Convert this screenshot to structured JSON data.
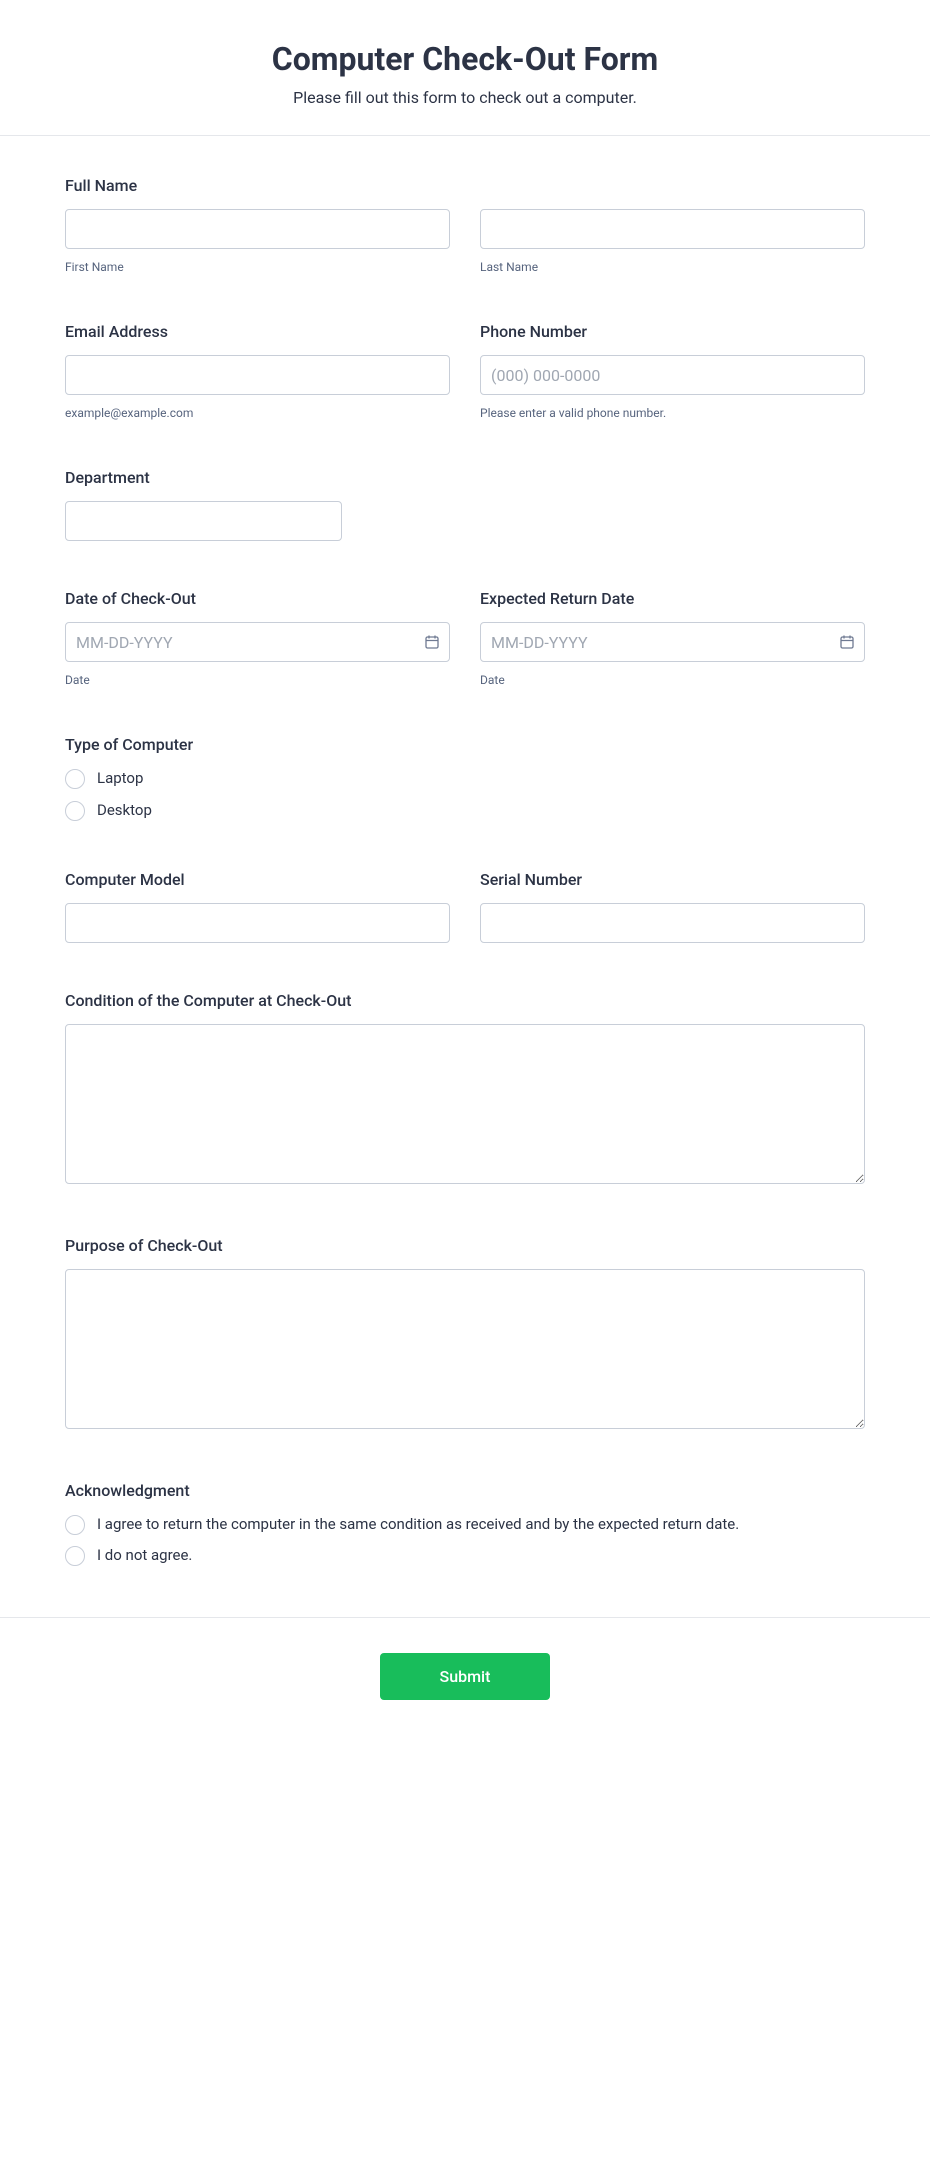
{
  "header": {
    "title": "Computer Check-Out Form",
    "subtitle": "Please fill out this form to check out a computer."
  },
  "fields": {
    "full_name": {
      "label": "Full Name",
      "first_sub": "First Name",
      "last_sub": "Last Name"
    },
    "email": {
      "label": "Email Address",
      "sub": "example@example.com"
    },
    "phone": {
      "label": "Phone Number",
      "placeholder": "(000) 000-0000",
      "sub": "Please enter a valid phone number."
    },
    "department": {
      "label": "Department"
    },
    "checkout_date": {
      "label": "Date of Check-Out",
      "placeholder": "MM-DD-YYYY",
      "sub": "Date"
    },
    "return_date": {
      "label": "Expected Return Date",
      "placeholder": "MM-DD-YYYY",
      "sub": "Date"
    },
    "computer_type": {
      "label": "Type of Computer",
      "options": {
        "laptop": "Laptop",
        "desktop": "Desktop"
      }
    },
    "model": {
      "label": "Computer Model"
    },
    "serial": {
      "label": "Serial Number"
    },
    "condition": {
      "label": "Condition of the Computer at Check-Out"
    },
    "purpose": {
      "label": "Purpose of Check-Out"
    },
    "ack": {
      "label": "Acknowledgment",
      "options": {
        "agree": "I agree to return the computer in the same condition as received and by the expected return date.",
        "disagree": "I do not agree."
      }
    }
  },
  "footer": {
    "submit": "Submit"
  }
}
